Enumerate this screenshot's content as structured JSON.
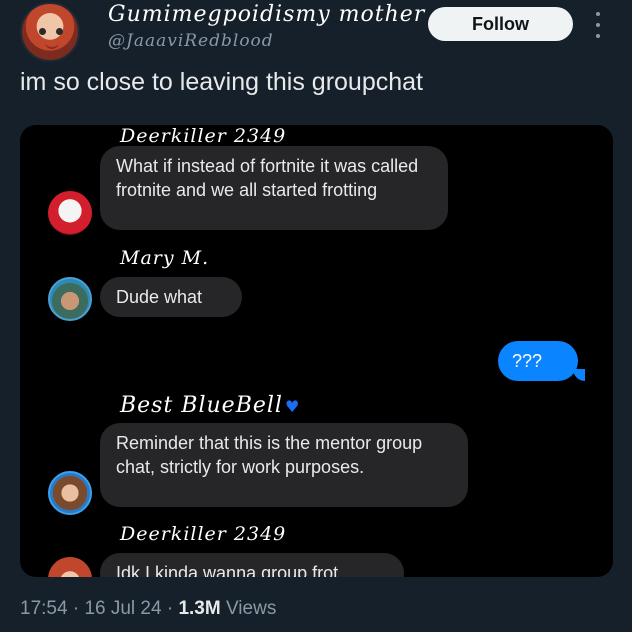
{
  "header": {
    "display_name": "Gumimegpoidismy mother",
    "handle": "@JaaaviRedblood",
    "follow_label": "Follow"
  },
  "tweet": {
    "text": "im so close to leaving this groupchat"
  },
  "chat": {
    "messages": [
      {
        "sender": "Deerkiller 2349",
        "text": "What if instead of fortnite it was called frotnite and we all started frotting"
      },
      {
        "sender": "Mary M.",
        "text": "Dude what"
      },
      {
        "sender": "",
        "text": "???"
      },
      {
        "sender": "Best BlueBell",
        "text": "Reminder that  this is the mentor group chat, strictly for work purposes."
      },
      {
        "sender": "Deerkiller 2349",
        "text": "Idk I kinda wanna group frot"
      }
    ]
  },
  "footer": {
    "time": "17:54",
    "sep1": " · ",
    "date": "16 Jul 24",
    "sep2": " · ",
    "views_count": "1.3M",
    "views_label": " Views"
  },
  "colors": {
    "background": "#15202b",
    "bubble_other": "#262629",
    "bubble_me": "#0a84ff",
    "heart": "#1d6df2"
  },
  "icons": [
    "avatar",
    "more-vertical-icon",
    "blue-heart-icon"
  ]
}
